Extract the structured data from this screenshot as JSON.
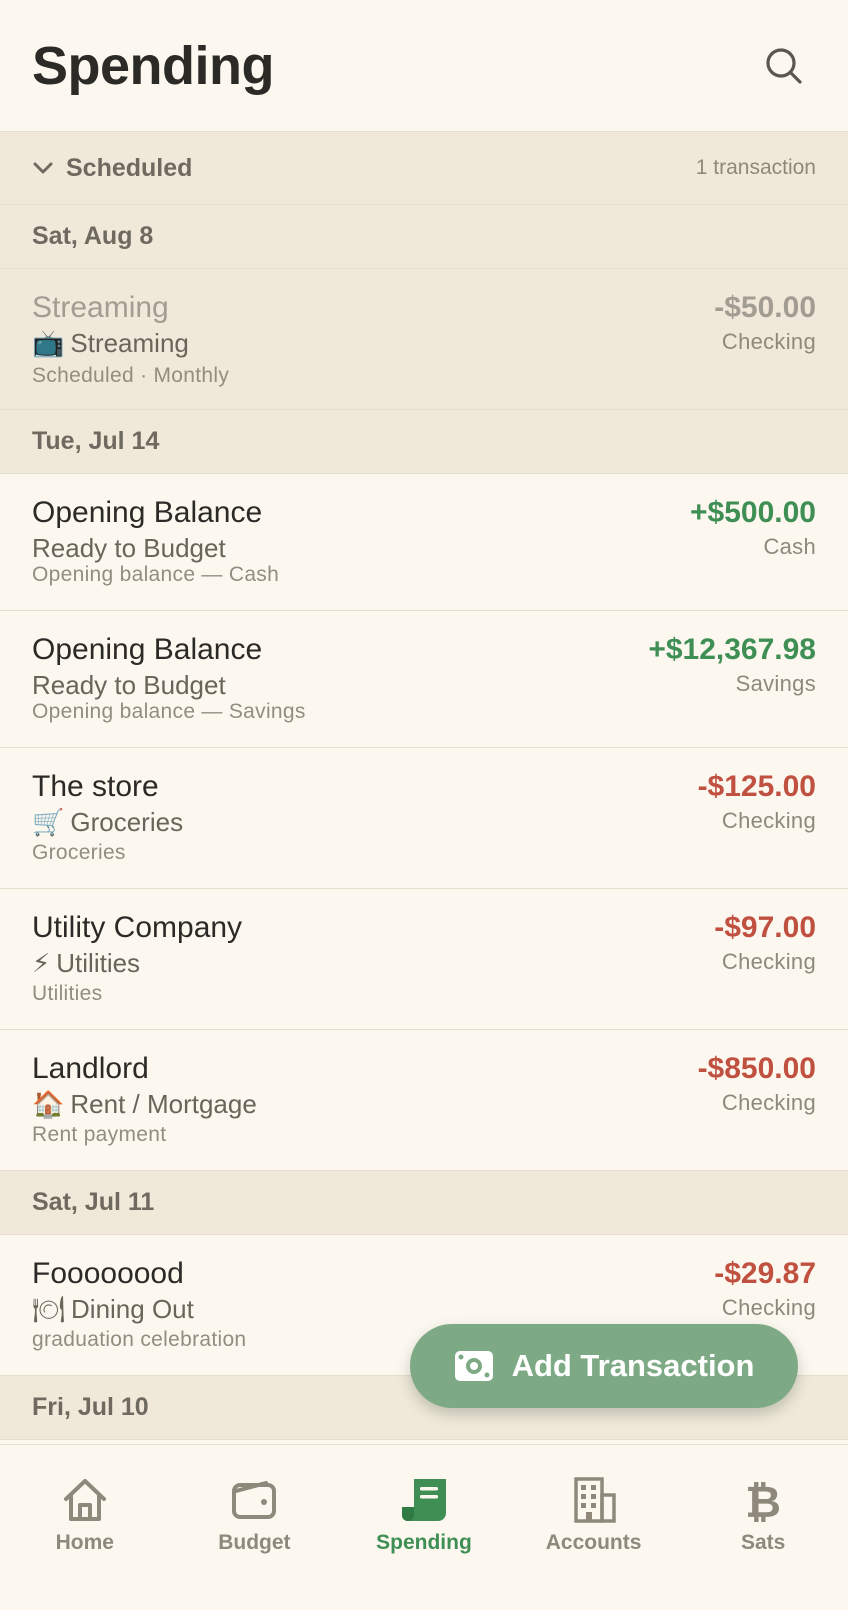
{
  "header": {
    "title": "Spending"
  },
  "scheduled": {
    "label": "Scheduled",
    "count": "1 transaction"
  },
  "groups": [
    {
      "date": "Sat, Aug 8"
    },
    {
      "date": "Tue, Jul 14"
    },
    {
      "date": "Sat, Jul 11"
    },
    {
      "date": "Fri, Jul 10"
    }
  ],
  "transactions": [
    {
      "payee": "Streaming",
      "category_icon": "📺",
      "category": "Streaming",
      "memo": "Scheduled · Monthly",
      "amount": "-$50.00",
      "account": "Checking",
      "state": "scheduled"
    },
    {
      "payee": "Opening Balance",
      "category_icon": "",
      "category": "Ready to Budget",
      "memo": "Opening balance — Cash",
      "amount": "+$500.00",
      "account": "Cash",
      "state": "inflow"
    },
    {
      "payee": "Opening Balance",
      "category_icon": "",
      "category": "Ready to Budget",
      "memo": "Opening balance — Savings",
      "amount": "+$12,367.98",
      "account": "Savings",
      "state": "inflow"
    },
    {
      "payee": "The store",
      "category_icon": "🛒",
      "category": "Groceries",
      "memo": "Groceries",
      "amount": "-$125.00",
      "account": "Checking",
      "state": "outflow"
    },
    {
      "payee": "Utility Company",
      "category_icon": "⚡",
      "category": "Utilities",
      "memo": "Utilities",
      "amount": "-$97.00",
      "account": "Checking",
      "state": "outflow"
    },
    {
      "payee": "Landlord",
      "category_icon": "🏠",
      "category": "Rent / Mortgage",
      "memo": "Rent payment",
      "amount": "-$850.00",
      "account": "Checking",
      "state": "outflow"
    },
    {
      "payee": "Foooooood",
      "category_icon": "🍽",
      "category": "Dining Out",
      "memo": "graduation celebration",
      "amount": "-$29.87",
      "account": "Checking",
      "state": "outflow"
    }
  ],
  "fab": {
    "label": "Add Transaction",
    "icon": "cash-icon"
  },
  "tabs": [
    {
      "label": "Home",
      "icon": "home-icon"
    },
    {
      "label": "Budget",
      "icon": "wallet-icon"
    },
    {
      "label": "Spending",
      "icon": "receipt-icon",
      "active": true
    },
    {
      "label": "Accounts",
      "icon": "building-icon"
    },
    {
      "label": "Sats",
      "icon": "bitcoin-icon"
    }
  ],
  "colors": {
    "background": "#fcf8f0",
    "section": "#f0e9da",
    "accent": "#3f8f55",
    "negative": "#c0503f",
    "fab": "#7daa85"
  }
}
